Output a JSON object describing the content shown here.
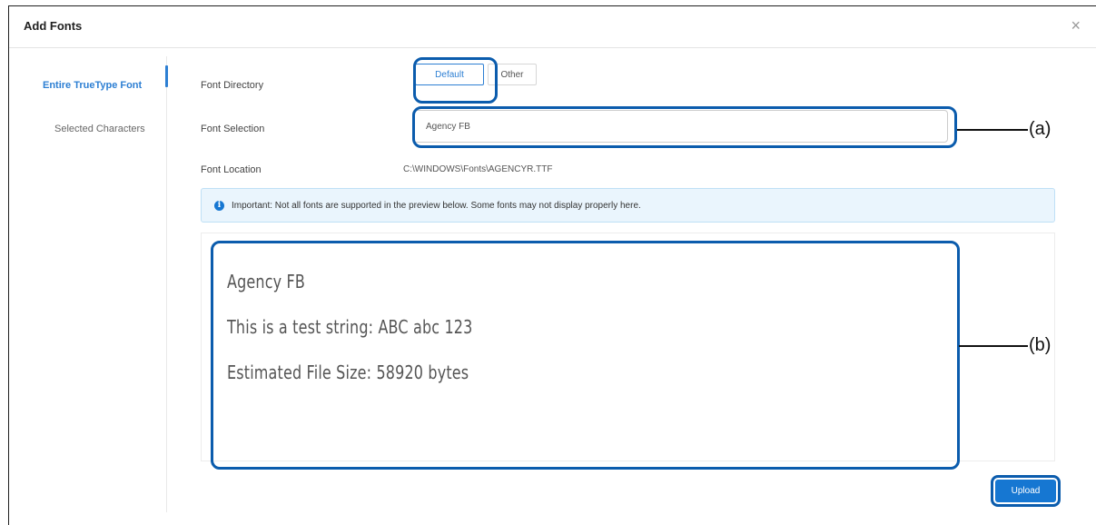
{
  "dialog": {
    "title": "Add Fonts",
    "close_icon": "×"
  },
  "sidebar": {
    "items": [
      {
        "label": "Entire TrueType Font",
        "active": true
      },
      {
        "label": "Selected Characters",
        "active": false
      }
    ]
  },
  "form": {
    "font_directory": {
      "label": "Font Directory",
      "options": [
        "Default",
        "Other"
      ],
      "selected": "Default"
    },
    "font_selection": {
      "label": "Font Selection",
      "value": "Agency FB"
    },
    "font_location": {
      "label": "Font Location",
      "value": "C:\\WINDOWS\\Fonts\\AGENCYR.TTF"
    }
  },
  "notice": {
    "icon": "info-icon",
    "text": "Important: Not all fonts are supported in the preview below. Some fonts may not display properly here."
  },
  "preview": {
    "lines": [
      "Agency FB",
      "This is a test string: ABC abc 123",
      "Estimated File Size: 58920 bytes"
    ]
  },
  "actions": {
    "upload_label": "Upload"
  },
  "callouts": {
    "a": "(a)",
    "b": "(b)"
  },
  "colors": {
    "accent": "#2d7fd3",
    "callout": "#0b5cad",
    "button": "#1677d2",
    "notice_bg": "#eaf5fd"
  }
}
